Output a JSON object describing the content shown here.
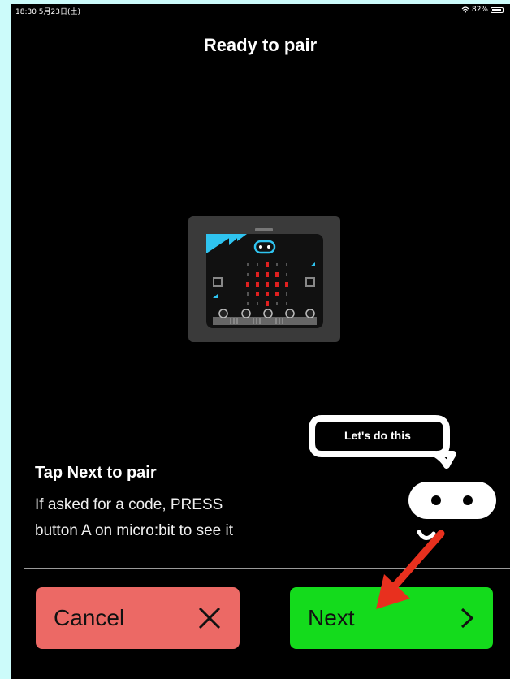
{
  "status_bar": {
    "time_date": "18:30  5月23日(土)",
    "battery": "82%"
  },
  "header": {
    "title": "Ready to pair"
  },
  "device_image": {
    "name": "micro:bit",
    "accent_color": "#2fc4f0",
    "led_color": "#e02020"
  },
  "mascot": {
    "speech": "Let's do this"
  },
  "instruction": {
    "title": "Tap Next to pair",
    "body_line1": "If asked for a code, PRESS",
    "body_line2": "button A on micro:bit to see it"
  },
  "buttons": {
    "cancel_label": "Cancel",
    "cancel_icon": "close-icon",
    "next_label": "Next",
    "next_icon": "chevron-right-icon"
  },
  "colors": {
    "cancel": "#ec6965",
    "next": "#14db1c",
    "annotation_arrow": "#e8301e"
  }
}
